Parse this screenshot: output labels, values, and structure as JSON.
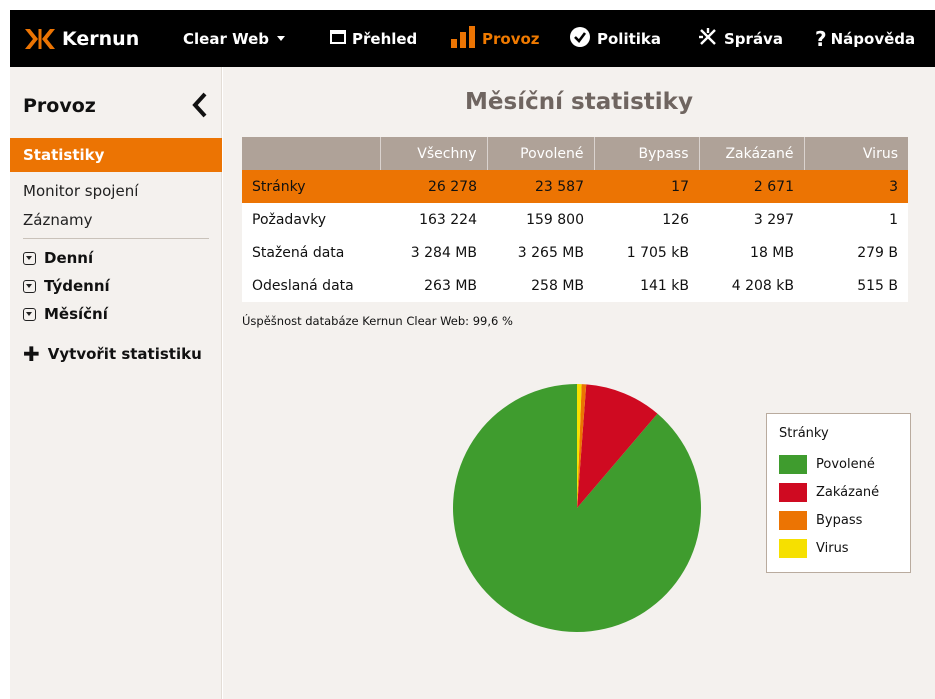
{
  "app": {
    "name": "Kernun"
  },
  "nav": {
    "product": "Clear Web",
    "items": [
      {
        "key": "prehled",
        "label": "Přehled"
      },
      {
        "key": "provoz",
        "label": "Provoz"
      },
      {
        "key": "politika",
        "label": "Politika"
      },
      {
        "key": "sprava",
        "label": "Správa"
      },
      {
        "key": "napoveda",
        "label": "Nápověda"
      }
    ]
  },
  "sidebar": {
    "title": "Provoz",
    "active": "Statistiky",
    "links": [
      "Monitor spojení",
      "Záznamy"
    ],
    "groups": [
      "Denní",
      "Týdenní",
      "Měsíční"
    ],
    "create": "Vytvořit statistiku"
  },
  "main": {
    "title": "Měsíční statistiky",
    "db_rate": "Úspěšnost databáze Kernun Clear Web: 99,6 %"
  },
  "table": {
    "headers": [
      "",
      "Všechny",
      "Povolené",
      "Bypass",
      "Zakázané",
      "Virus"
    ],
    "rows": [
      [
        "Stránky",
        "26 278",
        "23 587",
        "17",
        "2 671",
        "3"
      ],
      [
        "Požadavky",
        "163 224",
        "159 800",
        "126",
        "3 297",
        "1"
      ],
      [
        "Stažená data",
        "3 284 MB",
        "3 265 MB",
        "1 705 kB",
        "18 MB",
        "279 B"
      ],
      [
        "Odeslaná data",
        "263 MB",
        "258 MB",
        "141 kB",
        "4 208 kB",
        "515 B"
      ]
    ]
  },
  "colors": {
    "accent": "#ec7403",
    "povolene": "#3f9c2e",
    "zakazane": "#cf0a21",
    "bypass": "#ec7403",
    "virus": "#f6e000"
  },
  "chart_data": {
    "type": "pie",
    "title": "Stránky",
    "legend_position": "right",
    "categories": [
      "Povolené",
      "Zakázané",
      "Bypass",
      "Virus"
    ],
    "values": [
      23587,
      2671,
      17,
      3
    ],
    "colors": [
      "#3f9c2e",
      "#cf0a21",
      "#ec7403",
      "#f6e000"
    ]
  }
}
